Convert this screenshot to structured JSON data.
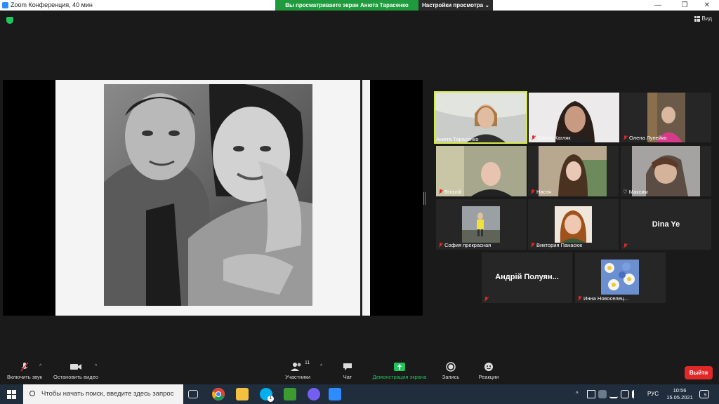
{
  "window": {
    "title": "Zoom Конференция, 40 мин",
    "minimize": "—",
    "maximize": "❐",
    "close": "✕"
  },
  "banner": {
    "viewing": "Вы просматриваете экран Анюта Тарасенко",
    "view_options": "Настройки просмотра ⌄"
  },
  "header": {
    "security_icon": "shield-icon",
    "view_label": "Вид"
  },
  "participants": [
    {
      "name": "Анюта Тарасенко",
      "muted": false,
      "active": true
    },
    {
      "name": "Олена Кагляк",
      "muted": true
    },
    {
      "name": "Олена Лунейко",
      "muted": true
    },
    {
      "name": "Віталій",
      "muted": true
    },
    {
      "name": "Настя",
      "muted": true
    },
    {
      "name": "Максим",
      "muted": false,
      "heart": "♡"
    },
    {
      "name": "София прекрасная",
      "muted": true
    },
    {
      "name": "Виктория Панасюк",
      "muted": true
    },
    {
      "name": "Dina Ye",
      "muted": true,
      "video": false
    },
    {
      "name": "Андрій Полуян...",
      "muted": true,
      "video": false
    },
    {
      "name": "Инна Новоселец...",
      "muted": true
    }
  ],
  "toolbar": {
    "unmute": "Включить звук",
    "start_video": "Остановить видео",
    "participants": "Участники",
    "participants_count": "11",
    "chat": "Чат",
    "share_screen": "Демонстрация экрана",
    "record": "Запись",
    "reactions": "Реакции",
    "leave": "Выйти",
    "caret": "^"
  },
  "taskbar": {
    "search_placeholder": "Чтобы начать поиск, введите здесь запрос",
    "language": "РУС",
    "time": "10:56",
    "date": "15.05.2021",
    "notifications": "5",
    "skype_badge": "1",
    "tray_chevron": "^"
  },
  "colors": {
    "share_green": "#23c35d",
    "leave_red": "#e02828",
    "active_speaker": "#d6e94a",
    "banner_green": "#1f9a3c"
  }
}
